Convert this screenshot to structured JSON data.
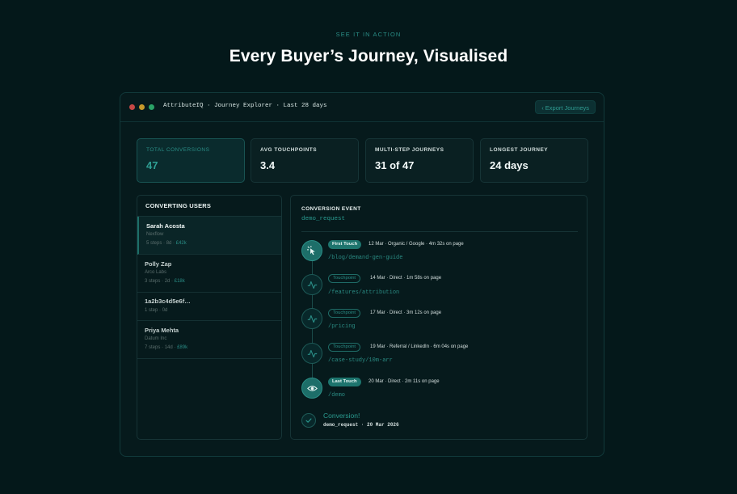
{
  "eyebrow": "SEE IT IN ACTION",
  "headline": "Every Buyer’s Journey, Visualised",
  "window": {
    "title": "AttributeIQ · Journey Explorer · Last 28 days",
    "export_label": "‹ Export Journeys"
  },
  "stats": [
    {
      "label": "TOTAL CONVERSIONS",
      "value": "47"
    },
    {
      "label": "AVG TOUCHPOINTS",
      "value": "3.4"
    },
    {
      "label": "MULTI-STEP JOURNEYS",
      "value": "31 of 47"
    },
    {
      "label": "LONGEST JOURNEY",
      "value": "24 days"
    }
  ],
  "users": {
    "header": "CONVERTING USERS",
    "items": [
      {
        "name": "Sarah Acosta",
        "company": "Nexflow",
        "steps": "5 steps",
        "days": "8d",
        "amount": "£42k"
      },
      {
        "name": "Polly Zap",
        "company": "Arco Labs",
        "steps": "3 steps",
        "days": "2d",
        "amount": "£18k"
      },
      {
        "name": "1a2b3c4d5e6f…",
        "company": "",
        "steps": "1 step",
        "days": "0d",
        "amount": ""
      },
      {
        "name": "Priya Mehta",
        "company": "Datum Inc",
        "steps": "7 steps",
        "days": "14d",
        "amount": "£89k"
      }
    ]
  },
  "journey": {
    "event_label": "CONVERSION EVENT",
    "event_value": "demo_request",
    "steps": [
      {
        "tag": "First Touch",
        "meta": "12 Mar · Organic / Google · 4m 32s on page",
        "path": "/blog/demand-gen-guide"
      },
      {
        "tag": "Touchpoint",
        "meta": "14 Mar · Direct · 1m 58s on page",
        "path": "/features/attribution"
      },
      {
        "tag": "Touchpoint",
        "meta": "17 Mar · Direct · 3m 12s on page",
        "path": "/pricing"
      },
      {
        "tag": "Touchpoint",
        "meta": "19 Mar · Referral / LinkedIn · 6m 04s on page",
        "path": "/case-study/10m-arr"
      },
      {
        "tag": "Last Touch",
        "meta": "20 Mar · Direct · 2m 11s on page",
        "path": "/demo"
      }
    ],
    "conversion_title": "Conversion!",
    "conversion_sub": "demo_request · 20 Mar 2026"
  },
  "colors": {
    "background": "#04181a",
    "accent": "#2a8d86",
    "accent_fill": "#1d746d"
  }
}
